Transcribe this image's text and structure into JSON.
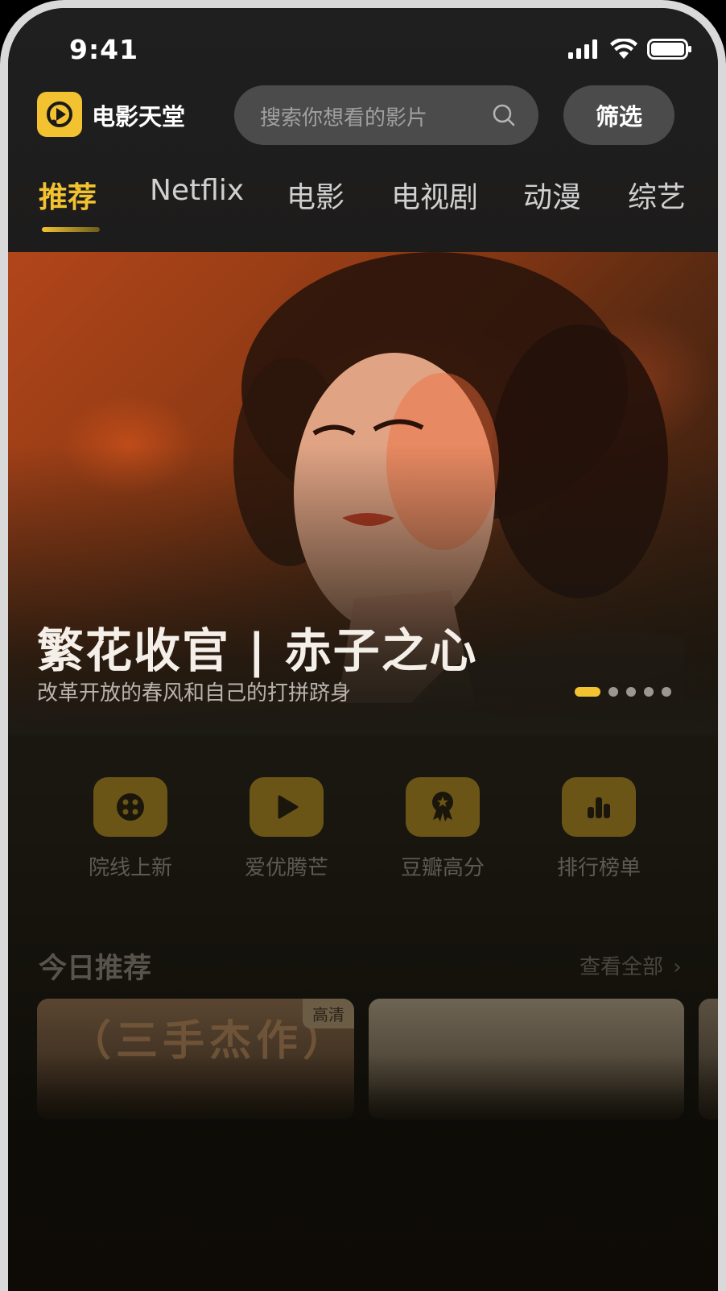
{
  "status_bar": {
    "time": "9:41",
    "icons": [
      "signal-icon",
      "wifi-icon",
      "battery-icon"
    ]
  },
  "header": {
    "app_name": "电影天堂",
    "logo_icon": "play-logo-icon",
    "search_placeholder": "搜索你想看的影片",
    "filter_label": "筛选"
  },
  "tabs": [
    {
      "label": "推荐",
      "active": true
    },
    {
      "label": "Netflix",
      "active": false
    },
    {
      "label": "电影",
      "active": false
    },
    {
      "label": "电视剧",
      "active": false
    },
    {
      "label": "动漫",
      "active": false
    },
    {
      "label": "综艺",
      "active": false
    }
  ],
  "hero": {
    "title": "繁花收官 | 赤子之心",
    "subtitle": "改革开放的春风和自己的打拼跻身",
    "slides_total": 5,
    "slide_active": 1
  },
  "quick_entries": [
    {
      "label": "院线上新",
      "icon": "film-reel-icon"
    },
    {
      "label": "爱优腾芒",
      "icon": "play-icon"
    },
    {
      "label": "豆瓣高分",
      "icon": "award-icon"
    },
    {
      "label": "排行榜单",
      "icon": "bar-chart-icon"
    }
  ],
  "today": {
    "title": "今日推荐",
    "see_all": "查看全部",
    "cards": [
      {
        "badge": "高清",
        "poster_text": "（三手杰作）"
      },
      {
        "badge": ""
      },
      {
        "badge": ""
      }
    ]
  },
  "colors": {
    "accent": "#f2c230",
    "search_bg": "#4b4b4c",
    "quick_icon_bg": "#6b5516"
  }
}
